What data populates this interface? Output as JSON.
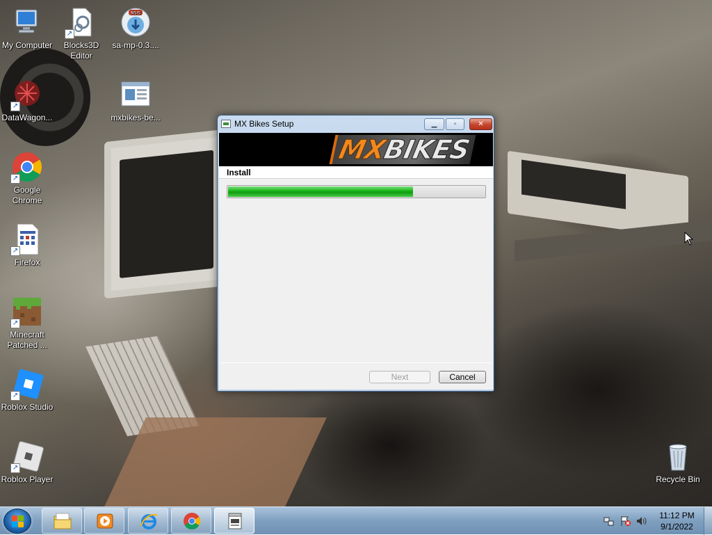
{
  "desktop": {
    "icons": [
      {
        "label": "My Computer"
      },
      {
        "label": "Blocks3D Editor"
      },
      {
        "label": "sa-mp-0.3...."
      },
      {
        "label": "DataWagon..."
      },
      {
        "label": "mxbikes-be..."
      },
      {
        "label": "Google Chrome"
      },
      {
        "label": "Firefox"
      },
      {
        "label": "Minecraft Patched ..."
      },
      {
        "label": "Roblox Studio"
      },
      {
        "label": "Roblox Player"
      },
      {
        "label": "Recycle Bin"
      }
    ],
    "nsis_badge": "NSIS"
  },
  "setup_window": {
    "title": "MX Bikes Setup",
    "logo_mx": "MX",
    "logo_bikes": "BIKES",
    "section": "Install",
    "progress_fraction": 0.72,
    "next_label": "Next",
    "cancel_label": "Cancel",
    "colors": {
      "progress": "#16b316",
      "logo_orange": "#f0891f"
    }
  },
  "taskbar": {
    "pinned": [
      "windows-explorer",
      "media-player",
      "internet-explorer",
      "google-chrome",
      "setup-installer"
    ],
    "clock_time": "11:12 PM",
    "clock_date": "9/1/2022",
    "tray_icons": [
      "network-icon",
      "flag-warning-icon",
      "volume-icon"
    ]
  }
}
